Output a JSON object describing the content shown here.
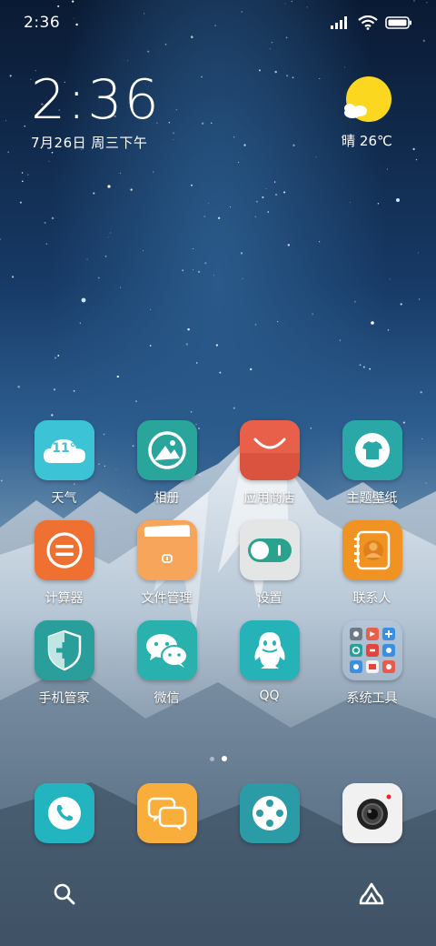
{
  "status_bar": {
    "time": "2:36"
  },
  "clock": {
    "time": "2:36",
    "date": "7月26日 周三下午"
  },
  "weather": {
    "text": "晴 26℃",
    "icon": "sun-cloud-icon"
  },
  "apps": [
    {
      "label": "天气",
      "icon": "weather-cloud-icon",
      "color": "#3cc4d6",
      "badge_text": "11°"
    },
    {
      "label": "相册",
      "icon": "gallery-icon",
      "color": "#2aa59c"
    },
    {
      "label": "应用商店",
      "icon": "shopping-bag-icon",
      "color": "#e8604a"
    },
    {
      "label": "主题壁纸",
      "icon": "tshirt-icon",
      "color": "#2aa8a8"
    },
    {
      "label": "计算器",
      "icon": "calculator-icon",
      "color": "#ee7132"
    },
    {
      "label": "文件管理",
      "icon": "folder-icon",
      "color": "#f7a55a"
    },
    {
      "label": "设置",
      "icon": "toggle-icon",
      "color": "#e4e6e6"
    },
    {
      "label": "联系人",
      "icon": "contacts-book-icon",
      "color": "#f09322"
    },
    {
      "label": "手机管家",
      "icon": "shield-plus-icon",
      "color": "#2a9e9a"
    },
    {
      "label": "微信",
      "icon": "wechat-icon",
      "color": "#28b1ad"
    },
    {
      "label": "QQ",
      "icon": "penguin-icon",
      "color": "#26b3b8"
    },
    {
      "label": "系统工具",
      "icon": "folder-grid-icon",
      "color": "#7e97ae"
    }
  ],
  "dock": [
    {
      "name": "phone",
      "icon": "phone-icon",
      "color": "#22b5c0"
    },
    {
      "name": "messages",
      "icon": "chat-bubbles-icon",
      "color": "#f9ad3b"
    },
    {
      "name": "browser",
      "icon": "browser-dots-icon",
      "color": "#2b9ca6"
    },
    {
      "name": "camera",
      "icon": "camera-icon",
      "color": "#f1f1f1"
    }
  ],
  "page_indicator": {
    "count": 2,
    "active": 2
  }
}
